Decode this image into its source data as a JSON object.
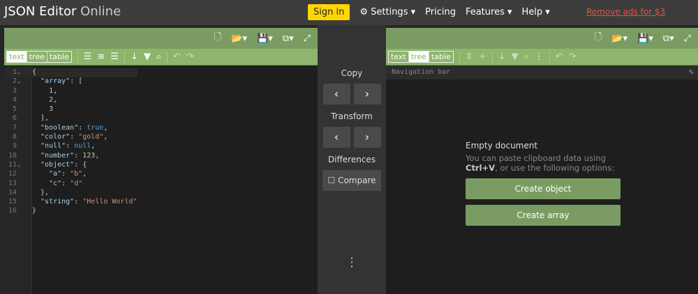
{
  "header": {
    "logo_main": "JSON Editor",
    "logo_sub": "Online",
    "signin": "Sign in",
    "settings": "Settings ▾",
    "pricing": "Pricing",
    "features": "Features ▾",
    "help": "Help ▾",
    "remove_ads": "Remove ads for $3"
  },
  "modes": {
    "text": "text",
    "tree": "tree",
    "table": "table"
  },
  "left": {
    "lines": [
      [
        {
          "c": "p",
          "v": "{"
        }
      ],
      [
        {
          "c": "k",
          "v": "  \"array\""
        },
        {
          "c": "p",
          "v": ": ["
        }
      ],
      [
        {
          "c": "nu",
          "v": "    1"
        },
        {
          "c": "p",
          "v": ","
        }
      ],
      [
        {
          "c": "nu",
          "v": "    2"
        },
        {
          "c": "p",
          "v": ","
        }
      ],
      [
        {
          "c": "nu",
          "v": "    3"
        }
      ],
      [
        {
          "c": "p",
          "v": "  ],"
        }
      ],
      [
        {
          "c": "k",
          "v": "  \"boolean\""
        },
        {
          "c": "p",
          "v": ": "
        },
        {
          "c": "b",
          "v": "true"
        },
        {
          "c": "p",
          "v": ","
        }
      ],
      [
        {
          "c": "k",
          "v": "  \"color\""
        },
        {
          "c": "p",
          "v": ": "
        },
        {
          "c": "s",
          "v": "\"gold\""
        },
        {
          "c": "p",
          "v": ","
        }
      ],
      [
        {
          "c": "k",
          "v": "  \"null\""
        },
        {
          "c": "p",
          "v": ": "
        },
        {
          "c": "b",
          "v": "null"
        },
        {
          "c": "p",
          "v": ","
        }
      ],
      [
        {
          "c": "k",
          "v": "  \"number\""
        },
        {
          "c": "p",
          "v": ": "
        },
        {
          "c": "nu",
          "v": "123"
        },
        {
          "c": "p",
          "v": ","
        }
      ],
      [
        {
          "c": "k",
          "v": "  \"object\""
        },
        {
          "c": "p",
          "v": ": {"
        }
      ],
      [
        {
          "c": "k",
          "v": "    \"a\""
        },
        {
          "c": "p",
          "v": ": "
        },
        {
          "c": "s",
          "v": "\"b\""
        },
        {
          "c": "p",
          "v": ","
        }
      ],
      [
        {
          "c": "k",
          "v": "    \"c\""
        },
        {
          "c": "p",
          "v": ": "
        },
        {
          "c": "s",
          "v": "\"d\""
        }
      ],
      [
        {
          "c": "p",
          "v": "  },"
        }
      ],
      [
        {
          "c": "k",
          "v": "  \"string\""
        },
        {
          "c": "p",
          "v": ": "
        },
        {
          "c": "s",
          "v": "\"Hello World\""
        }
      ],
      [
        {
          "c": "p",
          "v": "}"
        }
      ]
    ]
  },
  "middle": {
    "copy": "Copy",
    "transform": "Transform",
    "differences": "Differences",
    "compare": "Compare",
    "left_arrow": "‹",
    "right_arrow": "›"
  },
  "right": {
    "navbar": "Navigation bar",
    "empty_title": "Empty document",
    "empty_text": "You can paste clipboard data using",
    "shortcut": "Ctrl+V",
    "empty_text2": ", or use the following options:",
    "create_object": "Create object",
    "create_array": "Create array"
  }
}
